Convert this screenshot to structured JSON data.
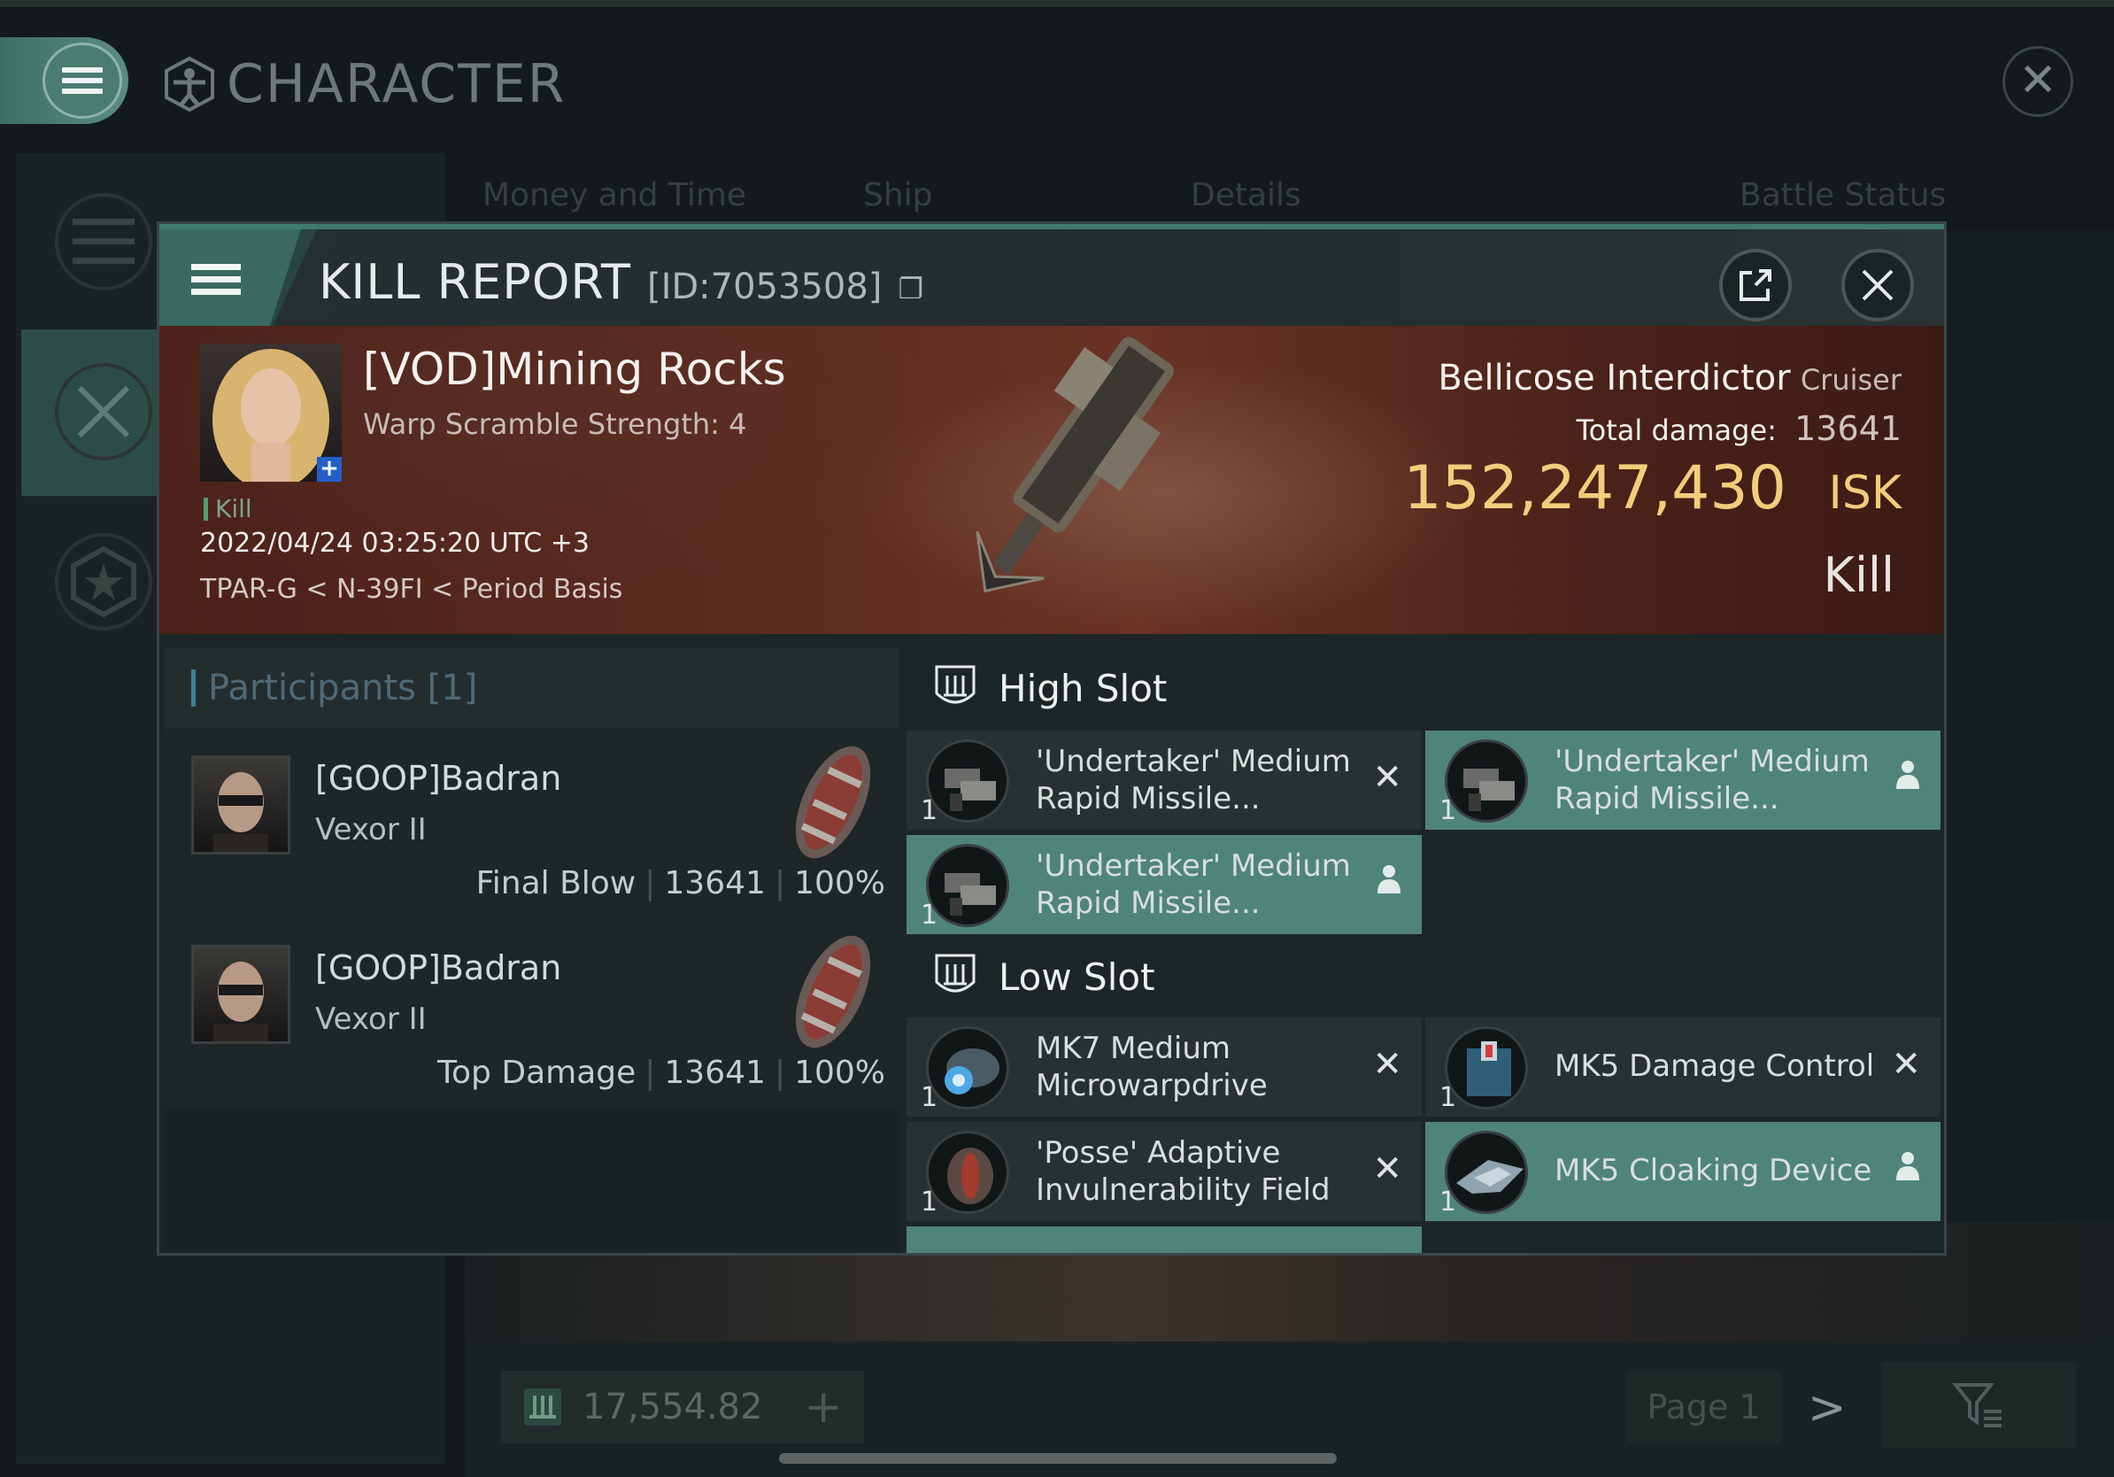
{
  "background": {
    "title": "CHARACTER",
    "tabs": [
      "Money and Time",
      "Ship",
      "Details",
      "Battle Status"
    ],
    "wallet_amount": "17,554.82",
    "page_label": "Page 1"
  },
  "modal": {
    "title": "KILL REPORT",
    "id": "[ID:7053508]",
    "victim": {
      "name": "[VOD]Mining Rocks",
      "warp_scramble": "Warp Scramble Strength: 4",
      "tag": "Kill",
      "time": "2022/04/24 03:25:20 UTC +3",
      "location": "TPAR-G < N-39FI < Period Basis"
    },
    "ship": {
      "name": "Bellicose Interdictor",
      "class": "Cruiser",
      "damage_label": "Total damage:",
      "damage_value": "13641",
      "isk_value": "152,247,430",
      "isk_unit": "ISK",
      "result": "Kill"
    },
    "participants": {
      "header": "Participants [1]",
      "rows": [
        {
          "name": "[GOOP]Badran",
          "ship": "Vexor II",
          "role": "Final Blow",
          "damage": "13641",
          "percent": "100%"
        },
        {
          "name": "[GOOP]Badran",
          "ship": "Vexor II",
          "role": "Top Damage",
          "damage": "13641",
          "percent": "100%"
        }
      ]
    },
    "high_slot": {
      "title": "High Slot",
      "items": [
        {
          "line1": "'Undertaker' Medium",
          "line2": "Rapid Missile...",
          "qty": "1",
          "state": "destroyed"
        },
        {
          "line1": "'Undertaker' Medium",
          "line2": "Rapid Missile...",
          "qty": "1",
          "state": "dropped"
        },
        {
          "line1": "'Undertaker' Medium",
          "line2": "Rapid Missile...",
          "qty": "1",
          "state": "dropped"
        }
      ]
    },
    "low_slot": {
      "title": "Low Slot",
      "items": [
        {
          "line1": "MK7 Medium",
          "line2": "Microwarpdrive",
          "qty": "1",
          "state": "destroyed"
        },
        {
          "line1": "MK5 Damage Control",
          "line2": "",
          "qty": "1",
          "state": "destroyed"
        },
        {
          "line1": "'Posse' Adaptive",
          "line2": "Invulnerability Field",
          "qty": "1",
          "state": "destroyed"
        },
        {
          "line1": "MK5 Cloaking Device",
          "line2": "",
          "qty": "1",
          "state": "dropped"
        }
      ]
    }
  },
  "colors": {
    "accent": "#4f8579",
    "isk_gold": "#f1cd7c",
    "banner_red": "#5b2a1f"
  }
}
